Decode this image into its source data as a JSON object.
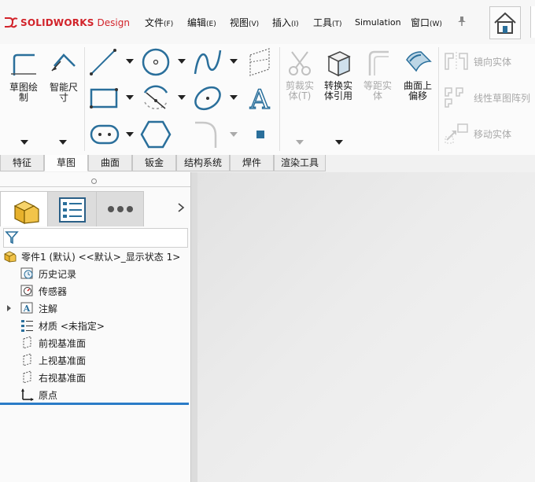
{
  "app": {
    "brand": "SOLIDWORKS",
    "product": "Design"
  },
  "menu": [
    {
      "label": "文件",
      "accel": "(F)"
    },
    {
      "label": "编辑",
      "accel": "(E)"
    },
    {
      "label": "视图",
      "accel": "(V)"
    },
    {
      "label": "插入",
      "accel": "(I)"
    },
    {
      "label": "工具",
      "accel": "(T)"
    },
    {
      "label": "Simulation",
      "accel": ""
    },
    {
      "label": "窗口",
      "accel": "(W)"
    }
  ],
  "ribbon": {
    "sketch_label": "草图绘\n制",
    "smart_dim_label": "智能尺\n寸",
    "trim_label": "剪裁实\n体(T)",
    "convert_label": "转换实\n体引用",
    "offset_label": "等距实\n体",
    "surface_offset_label": "曲面上\n偏移",
    "mirror_label": "镜向实体",
    "linear_pattern_label": "线性草图阵列",
    "move_label": "移动实体"
  },
  "tabs": [
    "特征",
    "草图",
    "曲面",
    "钣金",
    "结构系统",
    "焊件",
    "渲染工具"
  ],
  "active_tab": "草图",
  "tree": {
    "root": "零件1 (默认) <<默认>_显示状态 1>",
    "items": [
      {
        "label": "历史记录",
        "icon": "history-icon"
      },
      {
        "label": "传感器",
        "icon": "sensor-icon"
      },
      {
        "label": "注解",
        "icon": "annotation-icon"
      },
      {
        "label": "材质 <未指定>",
        "icon": "material-icon"
      },
      {
        "label": "前视基准面",
        "icon": "plane-icon"
      },
      {
        "label": "上视基准面",
        "icon": "plane-icon"
      },
      {
        "label": "右视基准面",
        "icon": "plane-icon"
      },
      {
        "label": "原点",
        "icon": "origin-icon"
      }
    ]
  },
  "colors": {
    "brand_red": "#d2232a",
    "icon_blue": "#2a6f9b",
    "selection_blue": "#2a7bc7"
  }
}
